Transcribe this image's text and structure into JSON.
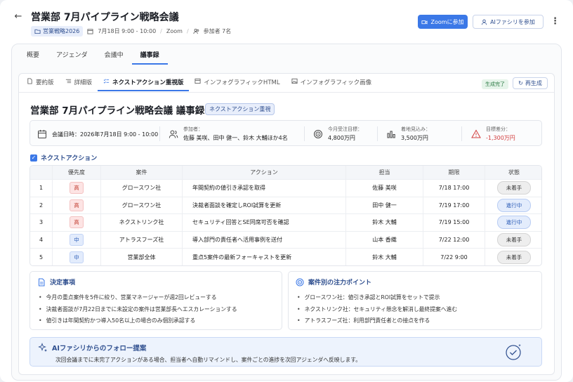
{
  "header": {
    "title": "営業部 7月パイプライン戦略会議",
    "folder_tag": "営業戦略2026",
    "datetime": "7月18日 9:00 - 10:00",
    "location": "Zoom",
    "attendees": "参加者 7名",
    "zoom_button": "Zoomに参加",
    "ai_button": "AIファシリを参加"
  },
  "main_tabs": [
    {
      "label": "概要"
    },
    {
      "label": "アジェンダ"
    },
    {
      "label": "会議中"
    },
    {
      "label": "議事録",
      "active": true
    }
  ],
  "sub_tabs": [
    {
      "label": "要約版",
      "icon": "document-icon"
    },
    {
      "label": "詳細版",
      "icon": "list-icon"
    },
    {
      "label": "ネクストアクション重視版",
      "icon": "checklist-icon",
      "active": true
    },
    {
      "label": "インフォグラフィックHTML",
      "icon": "layout-icon"
    },
    {
      "label": "インフォグラフィック画像",
      "icon": "image-icon"
    }
  ],
  "status_badge": "生成完了",
  "regenerate_button": "再生成",
  "doc": {
    "title": "営業部 7月パイプライン戦略会議 議事録",
    "badge": "ネクストアクション重視"
  },
  "info": {
    "datetime": "会議日時：2026年7月18日 9:00 - 10:00",
    "participants_label": "参加者：",
    "participants": "佐藤 美咲、田中 健一、鈴木 大輔ほか4名",
    "target_label": "今月受注目標：",
    "target": "4,800万円",
    "forecast_label": "着地見込み：",
    "forecast": "3,500万円",
    "gap_label": "目標差分：",
    "gap": "-1,300万円",
    "gap_color": "#d23b3b"
  },
  "next_actions": {
    "heading": "ネクストアクション",
    "columns": [
      "",
      "優先度",
      "案件",
      "アクション",
      "担当",
      "期限",
      "状態"
    ],
    "rows": [
      {
        "no": "1",
        "priority": "高",
        "level": "high",
        "project": "グロースワン社",
        "action": "年間契約の値引き承認を取得",
        "owner": "佐藤 美咲",
        "due": "7/18 17:00",
        "status": "未着手",
        "state": "todo"
      },
      {
        "no": "2",
        "priority": "高",
        "level": "high",
        "project": "グロースワン社",
        "action": "決裁者面談を確定しROI試算を更新",
        "owner": "田中 健一",
        "due": "7/19 17:00",
        "status": "進行中",
        "state": "prog"
      },
      {
        "no": "3",
        "priority": "高",
        "level": "high",
        "project": "ネクストリンク社",
        "action": "セキュリティ回答とSE同席可否を確認",
        "owner": "鈴木 大輔",
        "due": "7/19 15:00",
        "status": "進行中",
        "state": "prog"
      },
      {
        "no": "4",
        "priority": "中",
        "level": "mid",
        "project": "アトラスフーズ社",
        "action": "導入部門の責任者へ活用事例を送付",
        "owner": "山本 香織",
        "due": "7/22 12:00",
        "status": "未着手",
        "state": "todo"
      },
      {
        "no": "5",
        "priority": "中",
        "level": "mid",
        "project": "営業部全体",
        "action": "重点5案件の最新フォーキャストを更新",
        "owner": "鈴木 大輔",
        "due": "7/22 9:00",
        "status": "未着手",
        "state": "todo"
      }
    ]
  },
  "decisions": {
    "heading": "決定事項",
    "items": [
      "今月の重点案件を5件に絞り、営業マネージャーが週2回レビューする",
      "決裁者面談が7月22日までに未設定の案件は営業部長へエスカレーションする",
      "値引きは年間契約かつ導入50名以上の場合のみ個別承認する"
    ]
  },
  "focus_points": {
    "heading": "案件別の注力ポイント",
    "items": [
      "グロースワン社：値引き承認とROI試算をセットで提示",
      "ネクストリンク社：セキュリティ懸念を解消し最終提案へ進む",
      "アトラスフーズ社：利用部門責任者との接点を作る"
    ]
  },
  "ai_followup": {
    "heading": "AIファシリからのフォロー提案",
    "text": "次回会議までに未完了アクションがある場合、担当者へ自動リマインドし、案件ごとの進捗を次回アジェンダへ反映します。"
  },
  "colors": {
    "accent": "#3b78e7",
    "heading_blue": "#2f4f8f",
    "done_green": "#2e7d46"
  }
}
